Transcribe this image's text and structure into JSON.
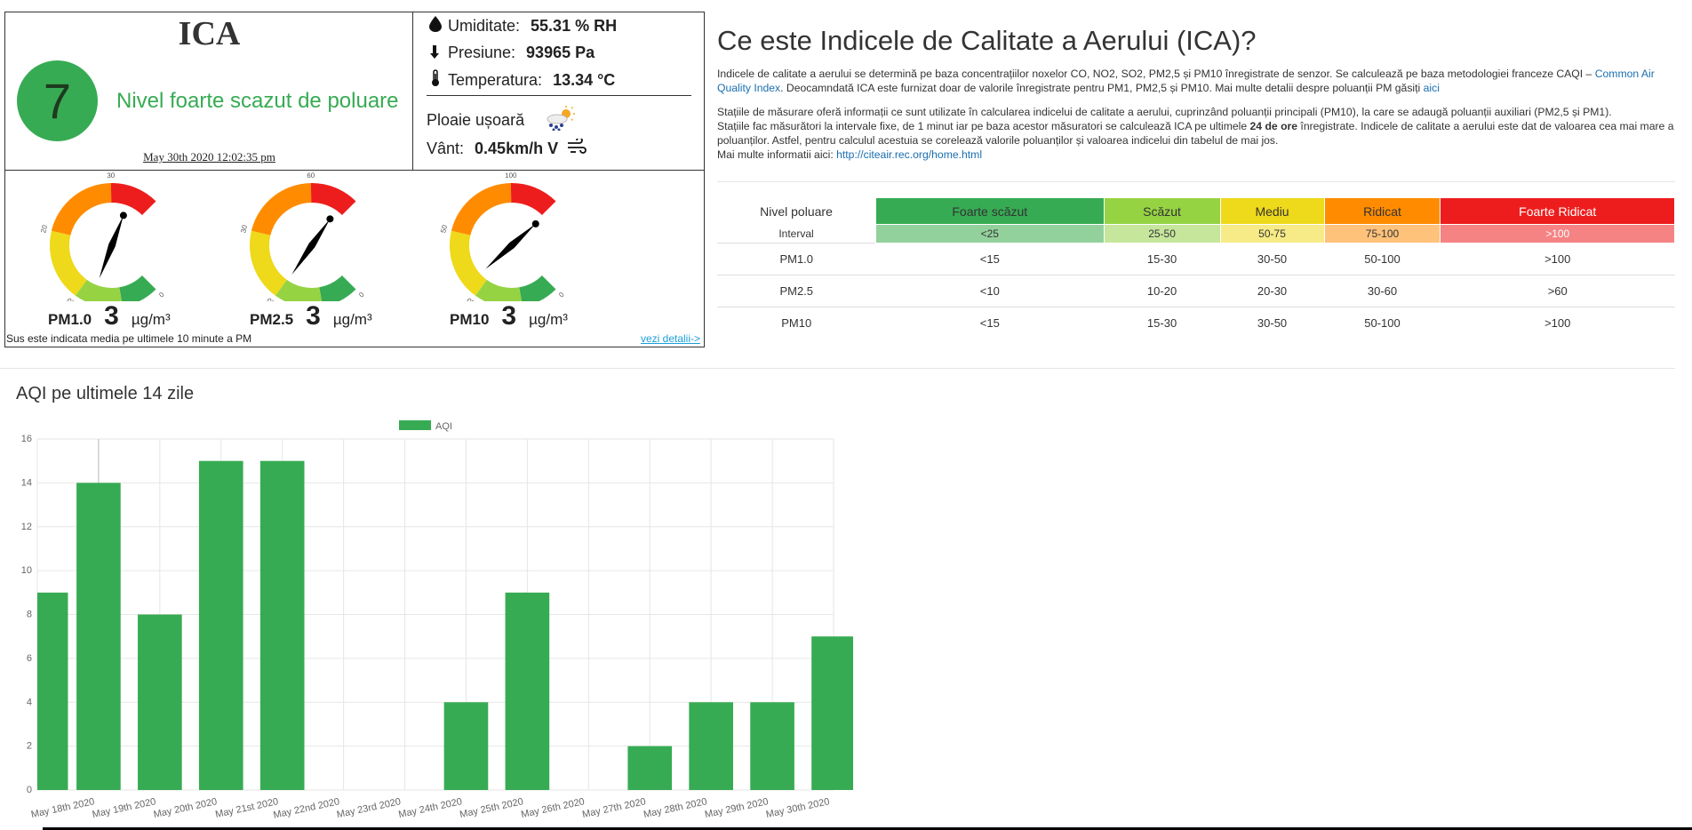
{
  "colors": {
    "very_low": "#37ab53",
    "low": "#96d343",
    "medium": "#eed91a",
    "high": "#ff8c00",
    "very_high": "#ee1d1d",
    "link": "#1a9fd9"
  },
  "ica": {
    "title": "ICA",
    "value": "7",
    "level_text": "Nivel foarte scazut de poluare",
    "date": "May 30th 2020 12:02:35 pm"
  },
  "weather": {
    "humidity_label": "Umiditate:",
    "humidity_value": "55.31 % RH",
    "pressure_label": "Presiune:",
    "pressure_value": "93965 Pa",
    "temperature_label": "Temperatura:",
    "temperature_value": "13.34 °C",
    "condition": "Ploaie ușoară",
    "condition_icon": "rain-sun-icon",
    "wind_label": "Vânt:",
    "wind_value": "0.45km/h V",
    "wind_icon": "wind-icon"
  },
  "gauges": [
    {
      "label": "PM1.0",
      "value": "3",
      "unit": "µg/m³",
      "max": 40,
      "current": 3,
      "ticks": [
        "0",
        "5",
        "10",
        "20",
        "30"
      ]
    },
    {
      "label": "PM2.5",
      "value": "3",
      "unit": "µg/m³",
      "max": 80,
      "current": 3,
      "ticks": [
        "0",
        "10",
        "20",
        "30",
        "60"
      ]
    },
    {
      "label": "PM10",
      "value": "3",
      "unit": "µg/m³",
      "max": 130,
      "current": 3,
      "ticks": [
        "0",
        "15",
        "30",
        "50",
        "100"
      ]
    }
  ],
  "widget_note": "Sus este indicata media pe ultimele 10 minute a PM",
  "details_link": "vezi detalii->",
  "info": {
    "title": "Ce este Indicele de Calitate a Aerului (ICA)?",
    "p1_text": "Indicele de calitate a aerului se determină pe baza concentrațiilor noxelor CO, NO2, SO2, PM2,5 și PM10 înregistrate de senzor. Se calculează pe baza metodologiei franceze CAQI – ",
    "p1_link": "Common Air Quality Index",
    "p1_text2": ". Deocamndată ICA este furnizat doar de valorile înregistrate pentru PM1, PM2,5 și PM10. Mai multe detalii despre poluanții PM găsiți ",
    "p1_link2": "aici",
    "p2_line1": "Stațiile de măsurare oferă informații ce sunt utilizate în calcularea indicelui de calitate a aerului, cuprinzând poluanții principali (PM10), la care se adaugă poluanții auxiliari (PM2,5 și PM1).",
    "p2_text_a": "Stațiile fac măsurători la intervale fixe, de 1 minut iar pe baza acestor măsuratori se calculează ICA pe ultimele ",
    "p2_bold": "24 de ore",
    "p2_text_b": " înregistrate. Indicele de calitate a aerului este dat de valoarea cea mai mare a poluanților. Astfel, pentru calculul acestuia se corelează valorile poluanților și valoarea indicelui din tabelul de mai jos.",
    "p2_more": "Mai multe informatii aici: ",
    "p2_url": "http://citeair.rec.org/home.html"
  },
  "table": {
    "row_header": "Nivel poluare",
    "levels": [
      "Foarte scăzut",
      "Scăzut",
      "Mediu",
      "Ridicat",
      "Foarte Ridicat"
    ],
    "interval_label": "Interval",
    "intervals": [
      "<25",
      "25-50",
      "50-75",
      "75-100",
      ">100"
    ],
    "rows": [
      {
        "name": "PM1.0",
        "values": [
          "<15",
          "15-30",
          "30-50",
          "50-100",
          ">100"
        ]
      },
      {
        "name": "PM2.5",
        "values": [
          "<10",
          "10-20",
          "20-30",
          "30-60",
          ">60"
        ]
      },
      {
        "name": "PM10",
        "values": [
          "<15",
          "15-30",
          "30-50",
          "50-100",
          ">100"
        ]
      }
    ]
  },
  "chart_section_title": "AQI pe ultimele 14 zile",
  "chart_data": {
    "type": "bar",
    "title": "",
    "legend": "top",
    "categories": [
      "May 18th 2020",
      "May 19th 2020",
      "May 20th 2020",
      "May 21st 2020",
      "May 22nd 2020",
      "May 23rd 2020",
      "May 24th 2020",
      "May 25th 2020",
      "May 26th 2020",
      "May 27th 2020",
      "May 28th 2020",
      "May 29th 2020",
      "May 30th 2020"
    ],
    "series": [
      {
        "name": "AQI",
        "color": "#37ab53",
        "values": [
          9,
          14,
          8,
          15,
          15,
          0,
          0,
          4,
          9,
          0,
          2,
          4,
          4,
          7
        ]
      }
    ],
    "first_partial_value": 9,
    "bar_values": [
      14,
      8,
      15,
      15,
      0,
      0,
      4,
      9,
      0,
      2,
      4,
      4,
      7
    ],
    "ylim": [
      0,
      16
    ],
    "yticks": [
      0,
      2,
      4,
      6,
      8,
      10,
      12,
      14,
      16
    ],
    "grid": true
  }
}
